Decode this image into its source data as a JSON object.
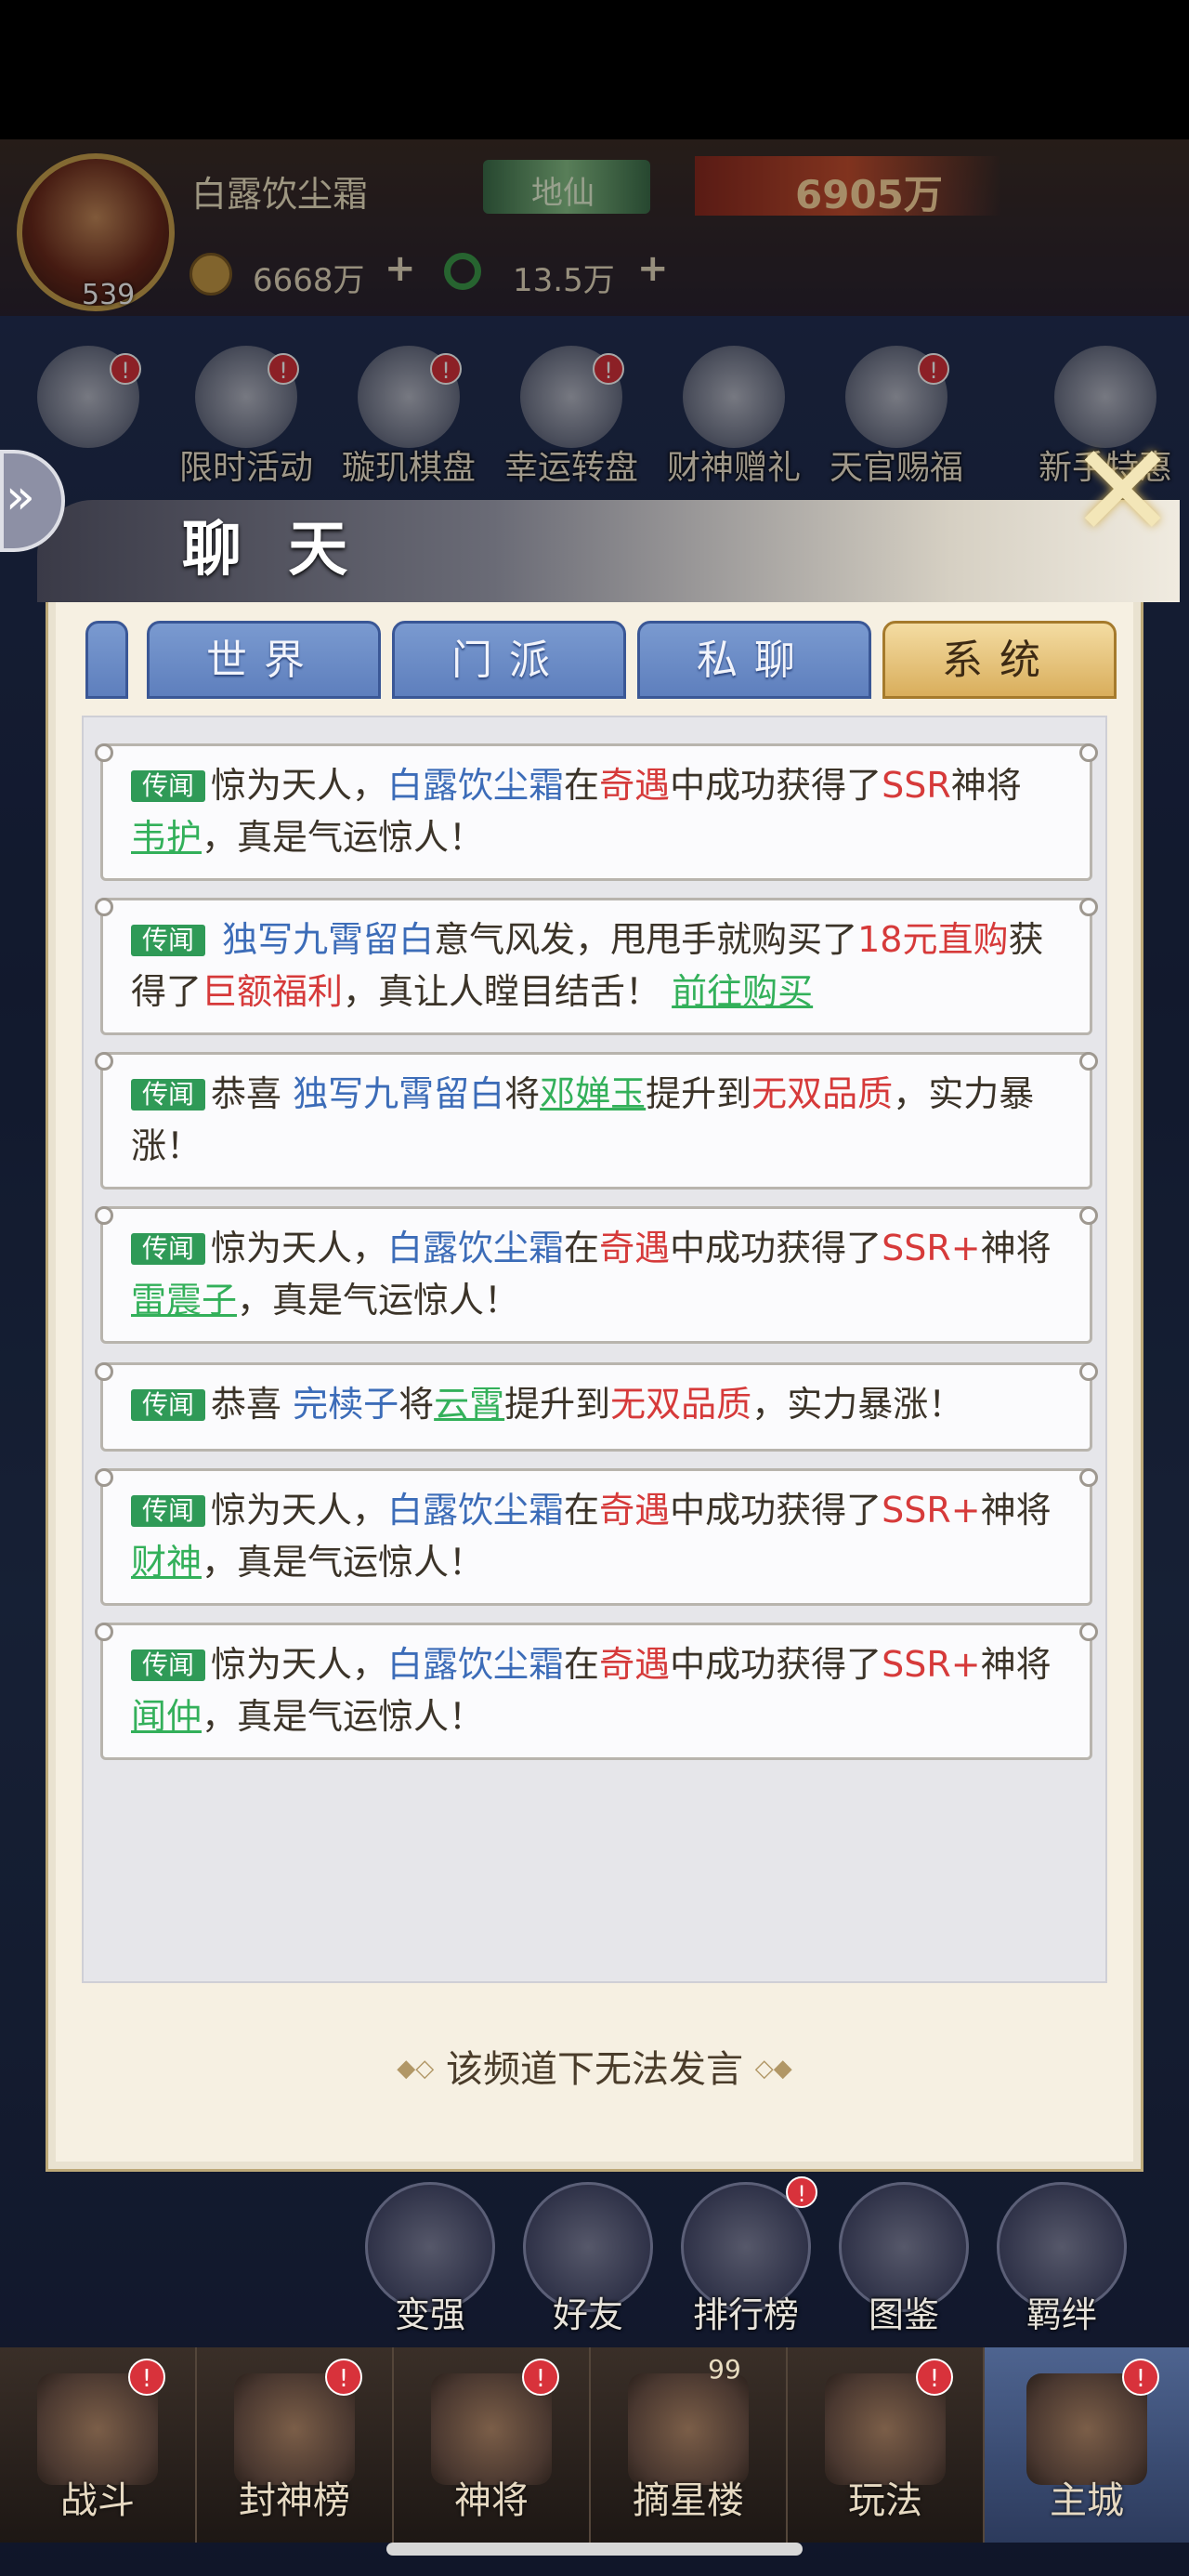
{
  "player": {
    "name": "白露饮尘霜",
    "level": "539",
    "rank": "地仙",
    "power": "6905万",
    "coins": "6668万",
    "jade": "13.5万",
    "plus": "+"
  },
  "activities": [
    {
      "label": "限时活动",
      "icon": "activity-icon"
    },
    {
      "label": "璇玑棋盘",
      "icon": "chessboard-icon"
    },
    {
      "label": "幸运转盘",
      "icon": "wheel-icon"
    },
    {
      "label": "财神赠礼",
      "icon": "gold-ingot-icon"
    },
    {
      "label": "天官赐福",
      "icon": "blessing-icon"
    },
    {
      "label": "新手特惠",
      "icon": "newbie-icon"
    }
  ],
  "chat": {
    "title": "聊 天",
    "tabs": [
      "世界",
      "门派",
      "私聊",
      "系统"
    ],
    "selected_tab": "系统",
    "tag": "传闻",
    "footer": "该频道下无法发言",
    "footer_left": "◆◇",
    "footer_right": "◇◆",
    "messages": [
      {
        "parts": [
          [
            "t",
            "惊为天人，"
          ],
          [
            "b",
            "白露饮尘霜"
          ],
          [
            "t",
            "在"
          ],
          [
            "r",
            "奇遇"
          ],
          [
            "t",
            "中成功获得了"
          ],
          [
            "r",
            "SSR"
          ],
          [
            "t",
            "神将"
          ],
          [
            "g",
            "韦护"
          ],
          [
            "t",
            "，真是气运惊人！"
          ]
        ]
      },
      {
        "parts": [
          [
            "b",
            " 独写九霄留白"
          ],
          [
            "t",
            "意气风发，甩甩手就购买了"
          ],
          [
            "r",
            "18元直购"
          ],
          [
            "t",
            "获得了"
          ],
          [
            "r",
            "巨额福利"
          ],
          [
            "t",
            "，真让人瞠目结舌！ "
          ],
          [
            "g",
            "前往购买"
          ]
        ]
      },
      {
        "parts": [
          [
            "t",
            "恭喜 "
          ],
          [
            "b",
            "独写九霄留白"
          ],
          [
            "t",
            "将"
          ],
          [
            "g",
            "邓婵玉"
          ],
          [
            "t",
            "提升到"
          ],
          [
            "r",
            "无双品质"
          ],
          [
            "t",
            "，实力暴涨！"
          ]
        ]
      },
      {
        "parts": [
          [
            "t",
            "惊为天人，"
          ],
          [
            "b",
            "白露饮尘霜"
          ],
          [
            "t",
            "在"
          ],
          [
            "r",
            "奇遇"
          ],
          [
            "t",
            "中成功获得了"
          ],
          [
            "r",
            "SSR+"
          ],
          [
            "t",
            "神将"
          ],
          [
            "g",
            "雷震子"
          ],
          [
            "t",
            "，真是气运惊人！"
          ]
        ]
      },
      {
        "parts": [
          [
            "t",
            "恭喜 "
          ],
          [
            "b",
            "完椟子"
          ],
          [
            "t",
            "将"
          ],
          [
            "g",
            "云霄"
          ],
          [
            "t",
            "提升到"
          ],
          [
            "r",
            "无双品质"
          ],
          [
            "t",
            "，实力暴涨！"
          ]
        ]
      },
      {
        "parts": [
          [
            "t",
            "惊为天人，"
          ],
          [
            "b",
            "白露饮尘霜"
          ],
          [
            "t",
            "在"
          ],
          [
            "r",
            "奇遇"
          ],
          [
            "t",
            "中成功获得了"
          ],
          [
            "r",
            "SSR+"
          ],
          [
            "t",
            "神将"
          ],
          [
            "g",
            "财神"
          ],
          [
            "t",
            "，真是气运惊人！"
          ]
        ]
      },
      {
        "parts": [
          [
            "t",
            "惊为天人，"
          ],
          [
            "b",
            "白露饮尘霜"
          ],
          [
            "t",
            "在"
          ],
          [
            "r",
            "奇遇"
          ],
          [
            "t",
            "中成功获得了"
          ],
          [
            "r",
            "SSR+"
          ],
          [
            "t",
            "神将"
          ],
          [
            "g",
            "闻仲"
          ],
          [
            "t",
            "，真是气运惊人！"
          ]
        ]
      }
    ]
  },
  "side_actions": [
    {
      "label": "变强",
      "icon": "fist-icon"
    },
    {
      "label": "好友",
      "icon": "friends-icon"
    },
    {
      "label": "排行榜",
      "icon": "trophy-icon"
    },
    {
      "label": "图鉴",
      "icon": "book-icon"
    },
    {
      "label": "羁绊",
      "icon": "bond-icon"
    }
  ],
  "nav": [
    {
      "label": "战斗",
      "icon": "battle-icon"
    },
    {
      "label": "封神榜",
      "icon": "scroll-icon"
    },
    {
      "label": "神将",
      "icon": "general-icon"
    },
    {
      "label": "摘星楼",
      "icon": "tower-icon",
      "badge": "99"
    },
    {
      "label": "玩法",
      "icon": "play-icon"
    },
    {
      "label": "主城",
      "icon": "city-icon"
    }
  ],
  "colors": {
    "tag_green": "#2f9a57",
    "name_blue": "#3c6cb8",
    "highlight_red": "#d63a3a",
    "link_green": "#33b05a",
    "tab_gold": "#d9ae5c",
    "tab_blue": "#5e7fbd"
  },
  "badge_mark": "!"
}
